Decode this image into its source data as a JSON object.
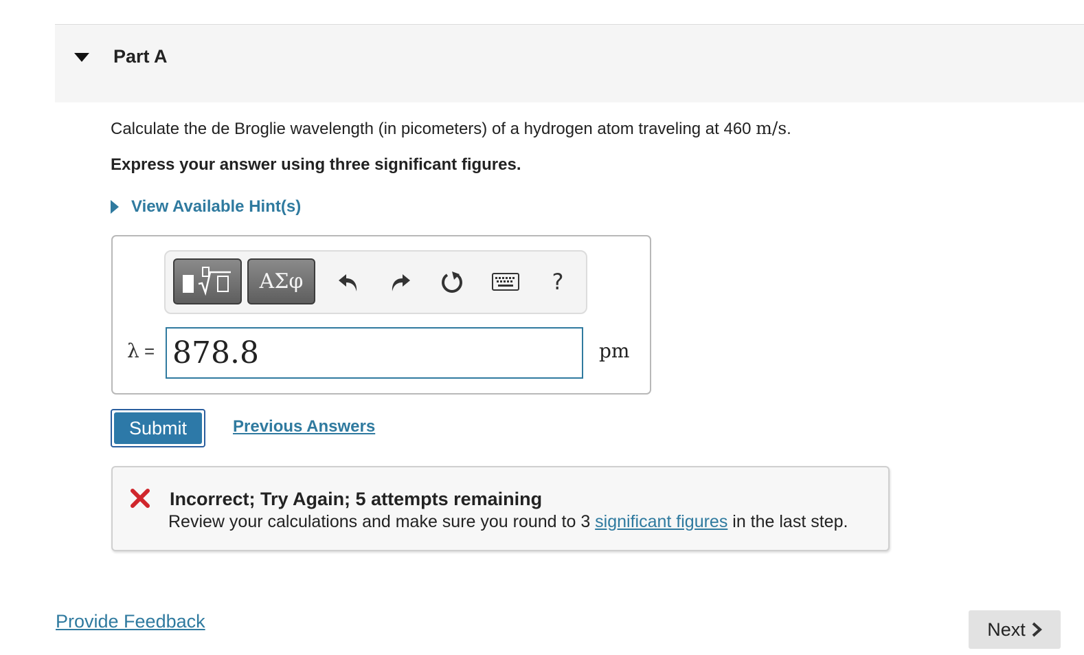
{
  "part": {
    "title": "Part A"
  },
  "question": {
    "text": "Calculate the de Broglie wavelength (in picometers) of a hydrogen atom traveling at 460 ",
    "unit": "m/s",
    "end": ".",
    "instruction": "Express your answer using three significant figures."
  },
  "hint": {
    "label": "View Available Hint(s)"
  },
  "toolbar": {
    "symbols_label": "ΑΣφ",
    "help_label": "?",
    "icons": [
      "templates-icon",
      "undo-icon",
      "redo-icon",
      "reset-icon",
      "keyboard-icon",
      "help-icon"
    ]
  },
  "answer": {
    "symbol": "λ",
    "equals": "=",
    "value": "878.8",
    "unit": "pm"
  },
  "actions": {
    "submit_label": "Submit",
    "previous_answers_label": "Previous Answers"
  },
  "feedback": {
    "title": "Incorrect; Try Again; 5 attempts remaining",
    "text_before": "Review your calculations and make sure you round to 3 ",
    "link": "significant figures",
    "text_after": " in the last step."
  },
  "footer": {
    "provide_feedback_label": "Provide Feedback",
    "next_label": "Next"
  },
  "colors": {
    "link": "#2f7a9f",
    "submit": "#2d79a8",
    "error": "#d0262c",
    "header_bg": "#f5f5f5"
  }
}
